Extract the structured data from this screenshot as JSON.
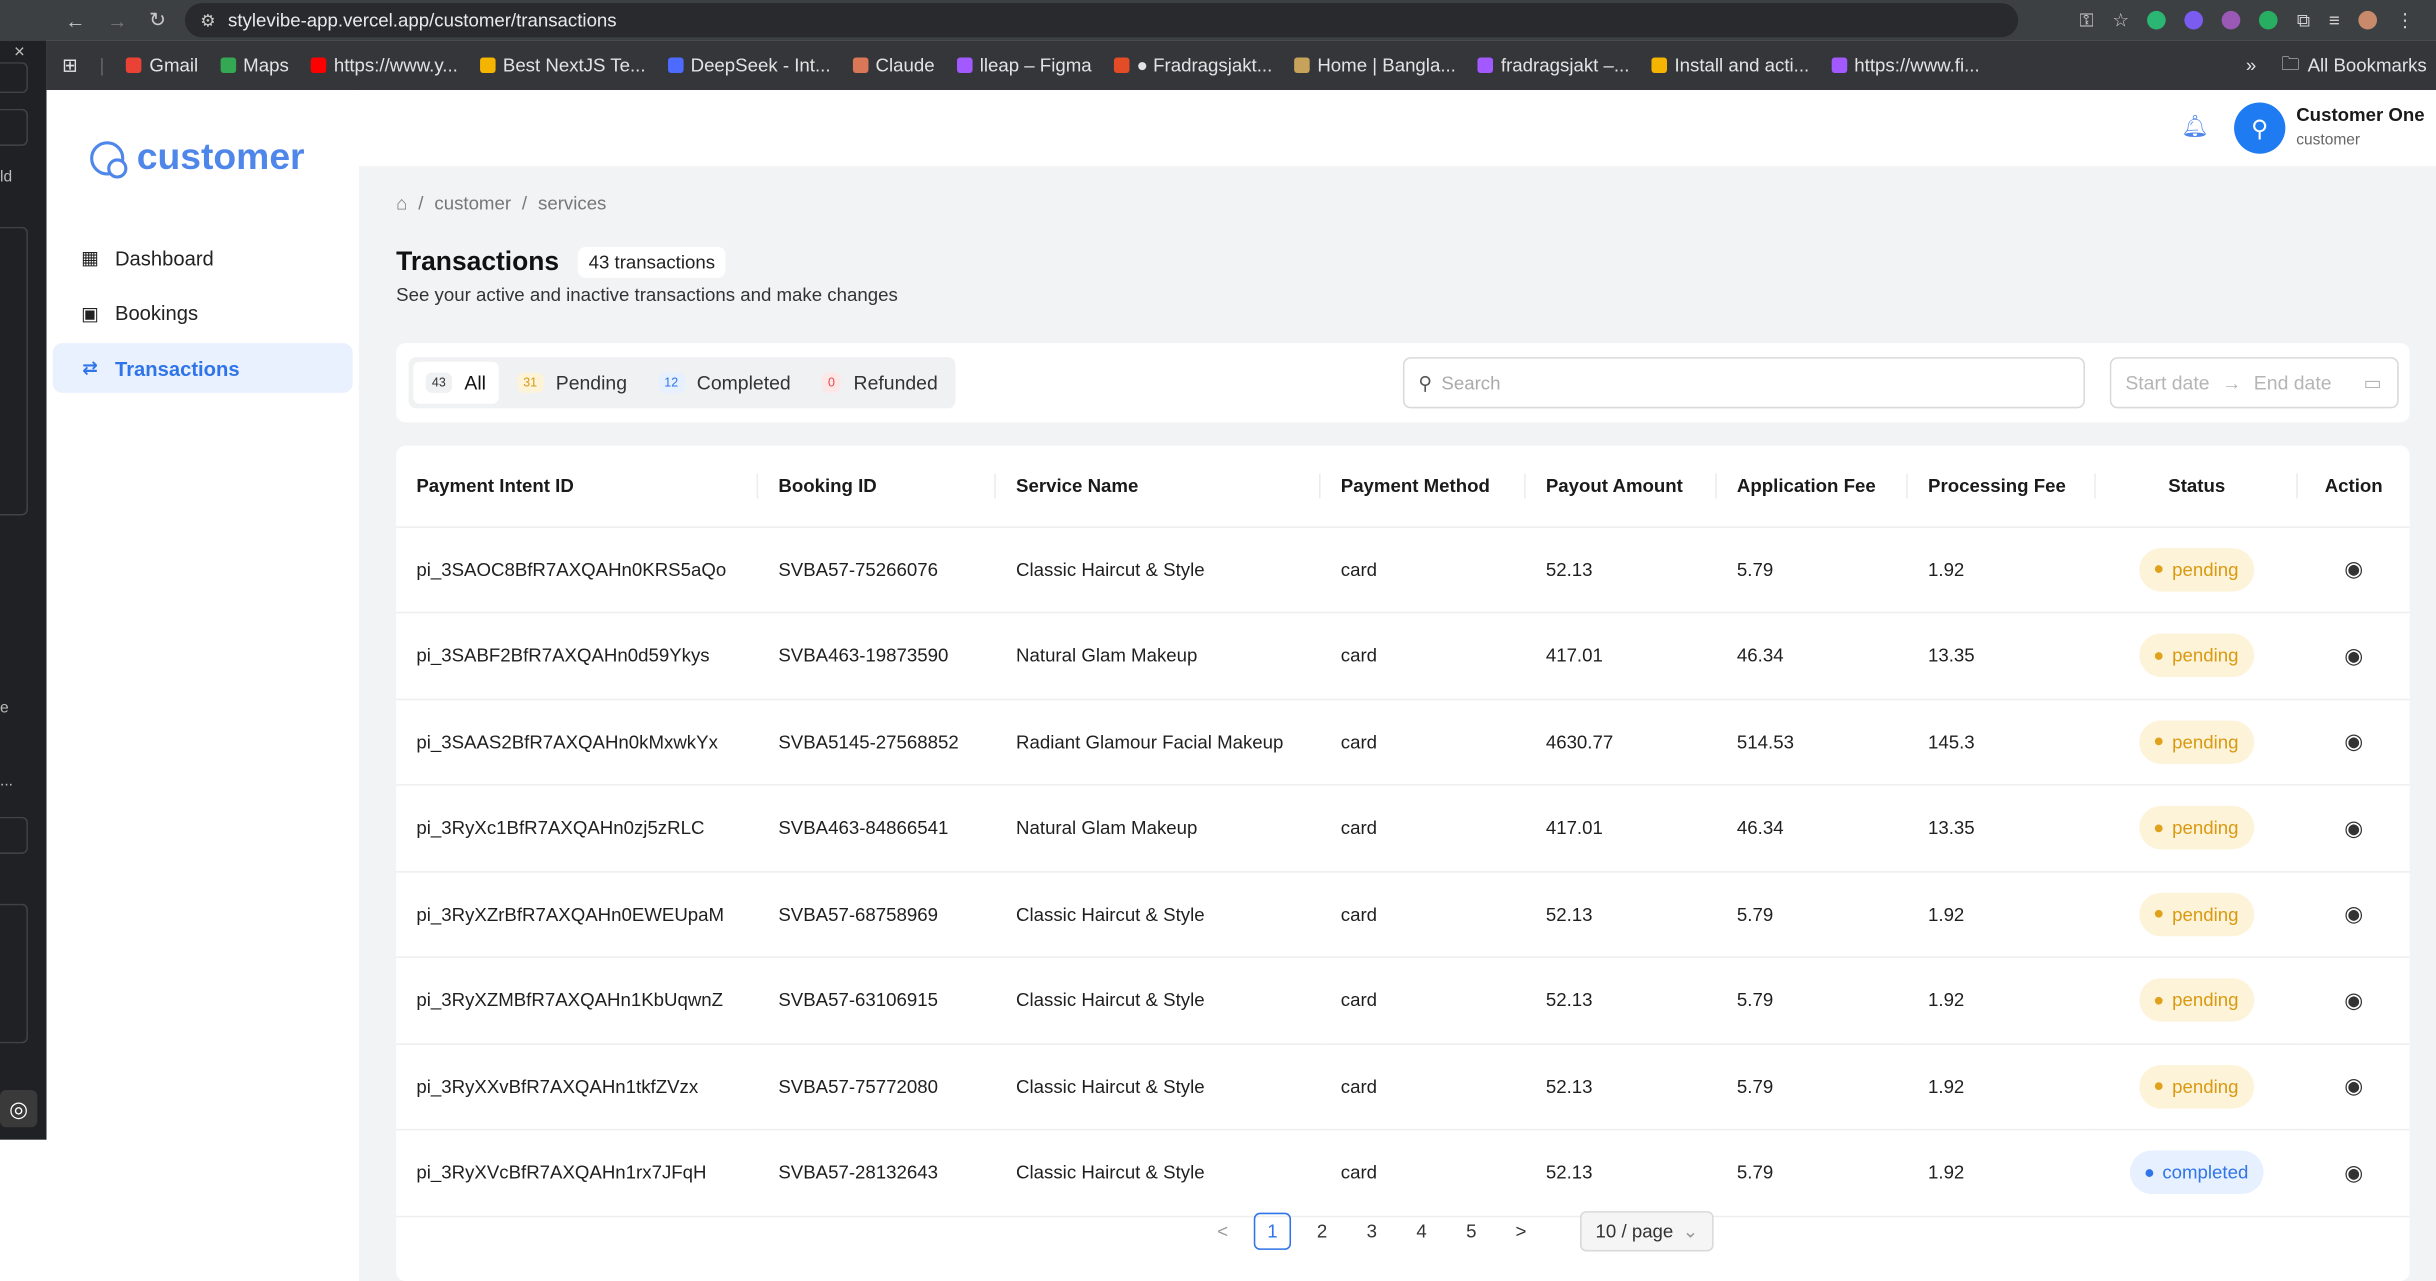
{
  "browser": {
    "url": "stylevibe-app.vercel.app/customer/transactions",
    "bookmarks": [
      {
        "label": "Gmail",
        "color": "#ea4335"
      },
      {
        "label": "Maps",
        "color": "#34a853"
      },
      {
        "label": "https://www.y...",
        "color": "#ff0000"
      },
      {
        "label": "Best NextJS Te...",
        "color": "#f4b400"
      },
      {
        "label": "DeepSeek - Int...",
        "color": "#4d6bfe"
      },
      {
        "label": "Claude",
        "color": "#d97757"
      },
      {
        "label": "lleap – Figma",
        "color": "#a259ff"
      },
      {
        "label": "● Fradragsjakt...",
        "color": "#e34c26"
      },
      {
        "label": "Home | Bangla...",
        "color": "#c6a25b"
      },
      {
        "label": "fradragsjakt –...",
        "color": "#a259ff"
      },
      {
        "label": "Install and acti...",
        "color": "#f4b400"
      },
      {
        "label": "https://www.fi...",
        "color": "#a259ff"
      }
    ],
    "all_bookmarks": "All Bookmarks"
  },
  "os_strip": {
    "close": "×",
    "frag1": "ld",
    "frag2": "e",
    "frag3": "..."
  },
  "sidebar": {
    "brand": "customer",
    "items": [
      {
        "label": "Dashboard",
        "icon": "grid-icon"
      },
      {
        "label": "Bookings",
        "icon": "bookings-icon"
      },
      {
        "label": "Transactions",
        "icon": "transactions-icon"
      }
    ]
  },
  "header": {
    "user_name": "Customer One",
    "user_role": "customer"
  },
  "breadcrumb": [
    "customer",
    "services"
  ],
  "page": {
    "title": "Transactions",
    "count": "43 transactions",
    "subtitle": "See your active and inactive transactions and make changes"
  },
  "filters": {
    "tabs": [
      {
        "count": "43",
        "label": "All",
        "color": "#333333",
        "bg": "#f0f1f3"
      },
      {
        "count": "31",
        "label": "Pending",
        "color": "#d99a12",
        "bg": "#fdf3d9"
      },
      {
        "count": "12",
        "label": "Completed",
        "color": "#2f74e8",
        "bg": "#e6f0ff"
      },
      {
        "count": "0",
        "label": "Refunded",
        "color": "#e5484d",
        "bg": "#fde8e8"
      }
    ],
    "search_placeholder": "Search",
    "start_date": "Start date",
    "end_date": "End date"
  },
  "table": {
    "columns": [
      "Payment Intent ID",
      "Booking ID",
      "Service Name",
      "Payment Method",
      "Payout Amount",
      "Application Fee",
      "Processing Fee",
      "Status",
      "Action"
    ],
    "rows": [
      [
        "pi_3SAOC8BfR7AXQAHn0KRS5aQo",
        "SVBA57-75266076",
        "Classic Haircut & Style",
        "card",
        "52.13",
        "5.79",
        "1.92",
        "pending"
      ],
      [
        "pi_3SABF2BfR7AXQAHn0d59Ykys",
        "SVBA463-19873590",
        "Natural Glam Makeup",
        "card",
        "417.01",
        "46.34",
        "13.35",
        "pending"
      ],
      [
        "pi_3SAAS2BfR7AXQAHn0kMxwkYx",
        "SVBA5145-27568852",
        "Radiant Glamour Facial Makeup",
        "card",
        "4630.77",
        "514.53",
        "145.3",
        "pending"
      ],
      [
        "pi_3RyXc1BfR7AXQAHn0zj5zRLC",
        "SVBA463-84866541",
        "Natural Glam Makeup",
        "card",
        "417.01",
        "46.34",
        "13.35",
        "pending"
      ],
      [
        "pi_3RyXZrBfR7AXQAHn0EWEUpaM",
        "SVBA57-68758969",
        "Classic Haircut & Style",
        "card",
        "52.13",
        "5.79",
        "1.92",
        "pending"
      ],
      [
        "pi_3RyXZMBfR7AXQAHn1KbUqwnZ",
        "SVBA57-63106915",
        "Classic Haircut & Style",
        "card",
        "52.13",
        "5.79",
        "1.92",
        "pending"
      ],
      [
        "pi_3RyXXvBfR7AXQAHn1tkfZVzx",
        "SVBA57-75772080",
        "Classic Haircut & Style",
        "card",
        "52.13",
        "5.79",
        "1.92",
        "pending"
      ],
      [
        "pi_3RyXVcBfR7AXQAHn1rx7JFqH",
        "SVBA57-28132643",
        "Classic Haircut & Style",
        "card",
        "52.13",
        "5.79",
        "1.92",
        "completed"
      ]
    ]
  },
  "pagination": {
    "pages": [
      "1",
      "2",
      "3",
      "4",
      "5"
    ],
    "current": "1",
    "prev": "<",
    "next": ">",
    "per_page": "10 / page"
  },
  "colors": {
    "accent": "#2f74e8",
    "brand": "#4f86ea",
    "pending": "#d99a12",
    "completed": "#2f74e8"
  }
}
